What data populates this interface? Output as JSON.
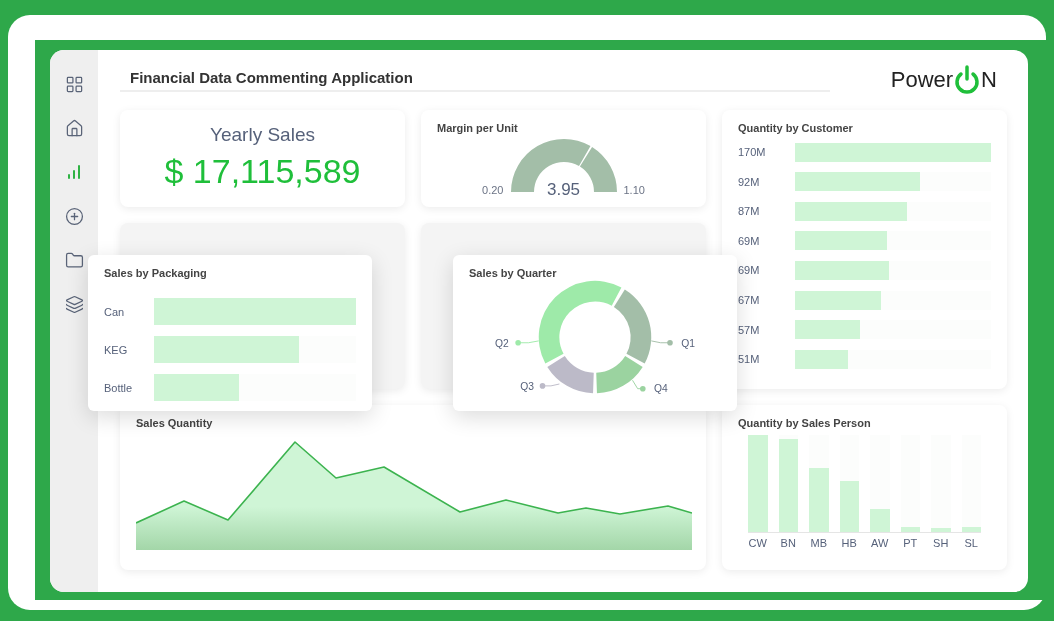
{
  "sidebar": {
    "items": [
      {
        "kind": "grid",
        "selected": false
      },
      {
        "kind": "home",
        "selected": false
      },
      {
        "kind": "chart",
        "selected": true
      },
      {
        "kind": "add",
        "selected": false
      },
      {
        "kind": "folder",
        "selected": false
      },
      {
        "kind": "layers",
        "selected": false
      }
    ]
  },
  "header": {
    "title": "Financial Data Commenting Application",
    "logo_before": "Power",
    "logo_after": "N"
  },
  "yearly_sales": {
    "title": "Yearly Sales",
    "value": "$ 17,115,589"
  },
  "margin_per_unit": {
    "title": "Margin per Unit",
    "min": "0.20",
    "value": "3.95",
    "max": "1.10"
  },
  "quantity_by_customer": {
    "title": "Quantity by Customer",
    "bars": [
      {
        "label": "170M",
        "level": 1
      },
      {
        "label": "92M",
        "level": 0.64
      },
      {
        "label": "87M",
        "level": 0.57
      },
      {
        "label": "69M",
        "level": 0.47
      },
      {
        "label": "69M",
        "level": 0.48
      },
      {
        "label": "67M",
        "level": 0.44
      },
      {
        "label": "57M",
        "level": 0.33
      },
      {
        "label": "51M",
        "level": 0.27
      }
    ]
  },
  "sales_by_packaging": {
    "title": "Sales by Packaging",
    "bars": [
      {
        "label": "Can",
        "level": 1
      },
      {
        "label": "KEG",
        "level": 0.72
      },
      {
        "label": "Bottle",
        "level": 0.42
      }
    ]
  },
  "sales_by_quarter": {
    "title": "Sales by Quarter",
    "slices": [
      {
        "label": "Q1",
        "color": "#a3bea8"
      },
      {
        "label": "Q4",
        "color": "#9bd3a0"
      },
      {
        "label": "Q3",
        "color": "#bcbac8"
      },
      {
        "label": "Q2",
        "color": "#9eeaa9"
      }
    ]
  },
  "sales_quantity": {
    "title": "Sales Quantity"
  },
  "quantity_by_sales_person": {
    "title": "Quantity by Sales Person",
    "bars": [
      {
        "label": "CW",
        "level": 1
      },
      {
        "label": "BN",
        "level": 0.96
      },
      {
        "label": "MB",
        "level": 0.66
      },
      {
        "label": "HB",
        "level": 0.53
      },
      {
        "label": "AW",
        "level": 0.24
      },
      {
        "label": "PT",
        "level": 0.05
      },
      {
        "label": "SH",
        "level": 0.04
      },
      {
        "label": "SL",
        "level": 0.05
      }
    ]
  }
}
